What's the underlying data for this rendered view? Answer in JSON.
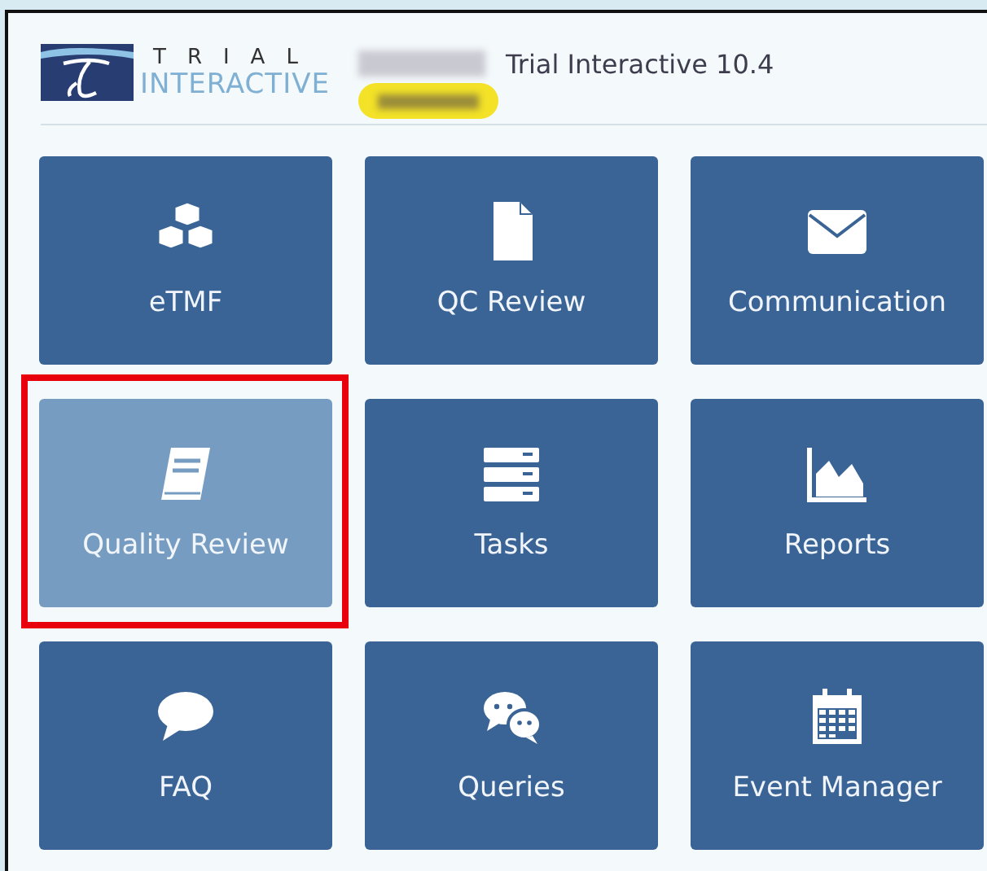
{
  "header": {
    "logo_top": "TRIAL",
    "logo_bottom": "INTERACTIVE",
    "app_title": "Trial Interactive 10.4"
  },
  "tiles": [
    {
      "label": "eTMF",
      "selected": false,
      "outlined": false
    },
    {
      "label": "QC Review",
      "selected": false,
      "outlined": false
    },
    {
      "label": "Communication",
      "selected": false,
      "outlined": false
    },
    {
      "label": "Quality Review",
      "selected": true,
      "outlined": true
    },
    {
      "label": "Tasks",
      "selected": false,
      "outlined": false
    },
    {
      "label": "Reports",
      "selected": false,
      "outlined": false
    },
    {
      "label": "FAQ",
      "selected": false,
      "outlined": false
    },
    {
      "label": "Queries",
      "selected": false,
      "outlined": false
    },
    {
      "label": "Event Manager",
      "selected": false,
      "outlined": false
    }
  ]
}
